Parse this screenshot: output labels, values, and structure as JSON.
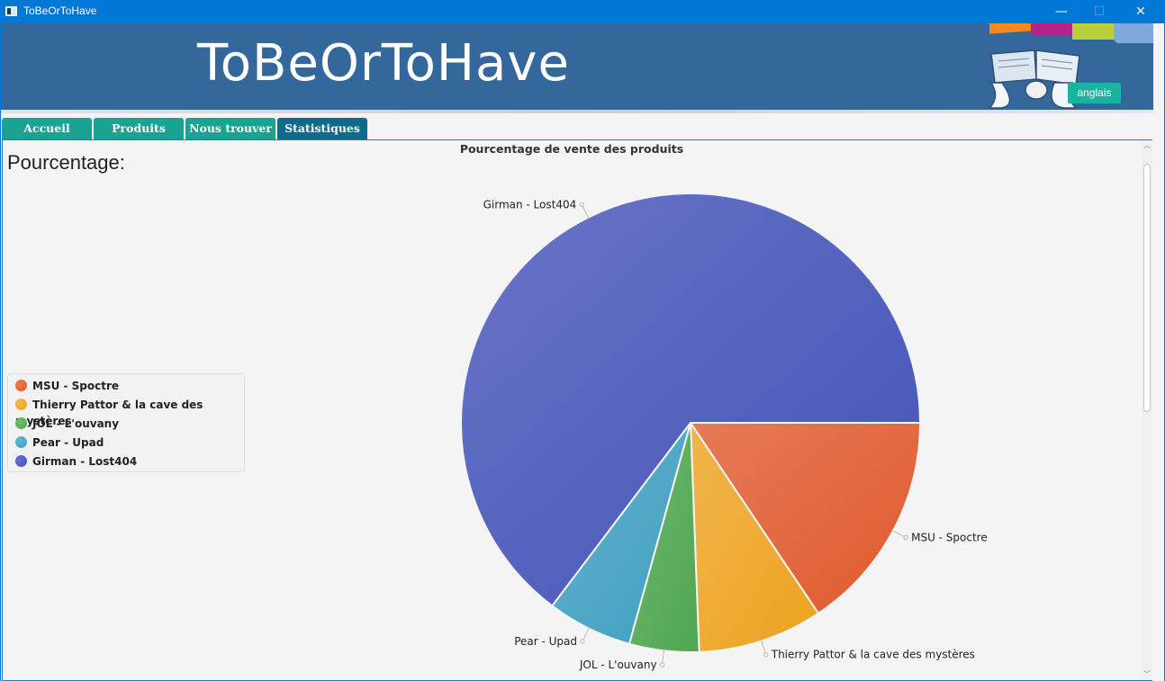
{
  "window": {
    "title": "ToBeOrToHave"
  },
  "titlebar": {
    "minimize": "—",
    "maximize": "☐",
    "close": "✕"
  },
  "banner": {
    "app_title": "ToBeOrToHave",
    "language_button": "anglais"
  },
  "tabs": [
    {
      "label": "Accueil",
      "active": false
    },
    {
      "label": "Produits",
      "active": false
    },
    {
      "label": "Nous trouver",
      "active": false
    },
    {
      "label": "Statistiques",
      "active": true
    }
  ],
  "content": {
    "section_label": "Pourcentage:"
  },
  "chart_data": {
    "type": "pie",
    "title": "Pourcentage de vente des produits",
    "legend_position": "left",
    "slices": [
      {
        "legend": "MSU - Spoctre",
        "label": "MSU -  Spoctre",
        "value": 15.6,
        "color": "#e0592d"
      },
      {
        "legend": "Thierry Pattor & la cave des mystères",
        "label": "Thierry Pattor & la cave des mystères",
        "value": 8.8,
        "color": "#eea21f"
      },
      {
        "legend": "JOL - L'ouvany",
        "label": "JOL -  L'ouvany",
        "value": 4.9,
        "color": "#4ea64f"
      },
      {
        "legend": "Pear - Upad",
        "label": "Pear -  Upad",
        "value": 6.0,
        "color": "#3f9fc0"
      },
      {
        "legend": "Girman - Lost404",
        "label": "Girman -  Lost404",
        "value": 64.7,
        "color": "#4352b8"
      }
    ]
  }
}
